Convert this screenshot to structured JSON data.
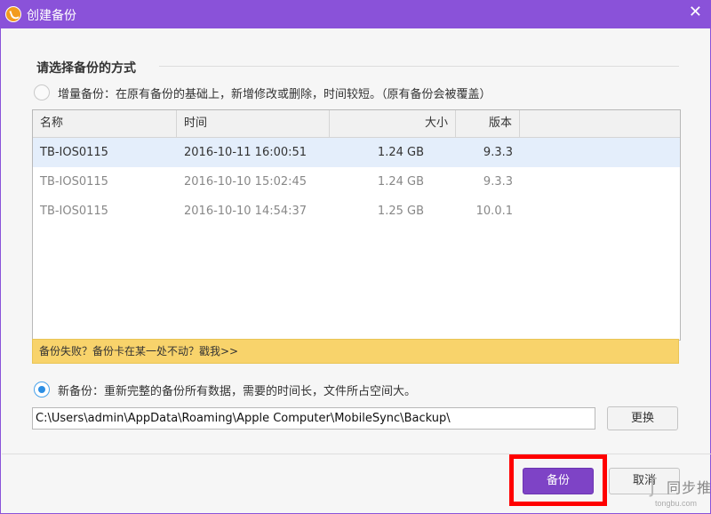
{
  "window": {
    "title": "创建备份",
    "close_glyph": "✕",
    "accent_color": "#8a52d9"
  },
  "section_title": "请选择备份的方式",
  "options": {
    "incremental": {
      "label": "增量备份：在原有备份的基础上，新增修改或删除，时间较短。（原有备份会被覆盖）",
      "selected": false
    },
    "new": {
      "label": "新备份：重新完整的备份所有数据，需要的时间长，文件所占空间大。",
      "selected": true
    }
  },
  "table": {
    "columns": [
      "名称",
      "时间",
      "大小",
      "版本"
    ],
    "rows": [
      {
        "name": "TB-IOS0115",
        "time": "2016-10-11 16:00:51",
        "size": "1.24 GB",
        "version": "9.3.3",
        "selected": true
      },
      {
        "name": "TB-IOS0115",
        "time": "2016-10-10 15:02:45",
        "size": "1.24 GB",
        "version": "9.3.3",
        "selected": false
      },
      {
        "name": "TB-IOS0115",
        "time": "2016-10-10 14:54:37",
        "size": "1.25 GB",
        "version": "10.0.1",
        "selected": false
      }
    ]
  },
  "help_banner": "备份失败？备份卡在某一处不动？戳我>>",
  "path": {
    "value": "C:\\Users\\admin\\AppData\\Roaming\\Apple Computer\\MobileSync\\Backup\\",
    "change_button": "更换"
  },
  "footer": {
    "backup_button": "备份",
    "cancel_button": "取消"
  },
  "watermark": {
    "icon": "tongbu-logo-icon",
    "text": "同步推",
    "url": "tongbu.com"
  }
}
